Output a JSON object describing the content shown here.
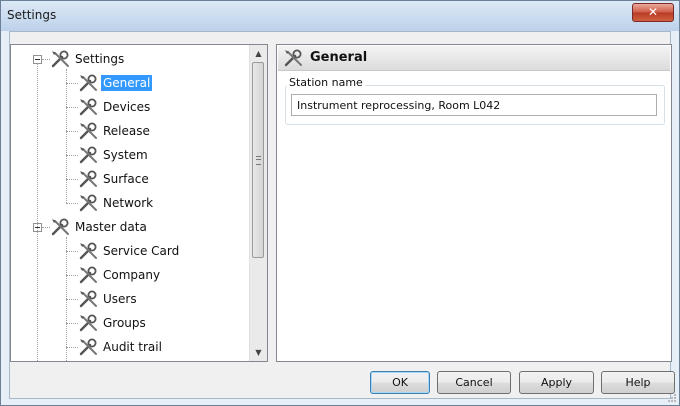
{
  "window": {
    "title": "Settings",
    "close_glyph": "✕"
  },
  "tree": {
    "items": [
      {
        "label": "Settings",
        "level": 0,
        "selected": false
      },
      {
        "label": "General",
        "level": 1,
        "selected": true
      },
      {
        "label": "Devices",
        "level": 1,
        "selected": false
      },
      {
        "label": "Release",
        "level": 1,
        "selected": false
      },
      {
        "label": "System",
        "level": 1,
        "selected": false
      },
      {
        "label": "Surface",
        "level": 1,
        "selected": false
      },
      {
        "label": "Network",
        "level": 1,
        "selected": false
      },
      {
        "label": "Master data",
        "level": 0,
        "selected": false
      },
      {
        "label": "Service Card",
        "level": 1,
        "selected": false
      },
      {
        "label": "Company",
        "level": 1,
        "selected": false
      },
      {
        "label": "Users",
        "level": 1,
        "selected": false
      },
      {
        "label": "Groups",
        "level": 1,
        "selected": false
      },
      {
        "label": "Audit trail",
        "level": 1,
        "selected": false
      }
    ],
    "icon": "tools-icon",
    "scroll_up_glyph": "▲",
    "scroll_down_glyph": "▼"
  },
  "panel": {
    "title": "General",
    "station_label": "Station name",
    "station_value": "Instrument reprocessing, Room L042"
  },
  "buttons": {
    "ok": "OK",
    "cancel": "Cancel",
    "apply": "Apply",
    "help": "Help"
  },
  "colors": {
    "selection": "#3399ff",
    "title_bar": "#c9dbef",
    "close_button": "#cf5a45"
  }
}
